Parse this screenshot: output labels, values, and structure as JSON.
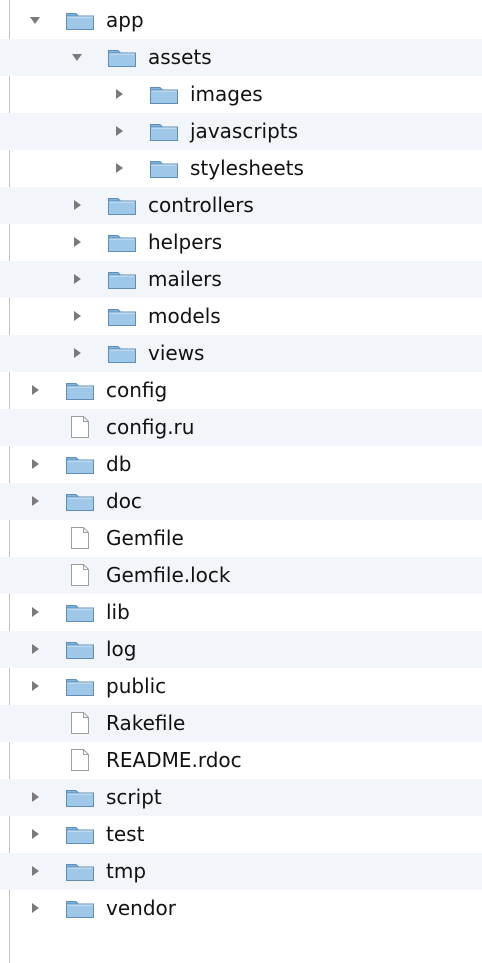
{
  "tree": {
    "items": [
      {
        "label": "app",
        "type": "folder",
        "expanded": true,
        "depth": 0
      },
      {
        "label": "assets",
        "type": "folder",
        "expanded": true,
        "depth": 1
      },
      {
        "label": "images",
        "type": "folder",
        "expanded": false,
        "depth": 2
      },
      {
        "label": "javascripts",
        "type": "folder",
        "expanded": false,
        "depth": 2
      },
      {
        "label": "stylesheets",
        "type": "folder",
        "expanded": false,
        "depth": 2
      },
      {
        "label": "controllers",
        "type": "folder",
        "expanded": false,
        "depth": 1
      },
      {
        "label": "helpers",
        "type": "folder",
        "expanded": false,
        "depth": 1
      },
      {
        "label": "mailers",
        "type": "folder",
        "expanded": false,
        "depth": 1
      },
      {
        "label": "models",
        "type": "folder",
        "expanded": false,
        "depth": 1
      },
      {
        "label": "views",
        "type": "folder",
        "expanded": false,
        "depth": 1
      },
      {
        "label": "config",
        "type": "folder",
        "expanded": false,
        "depth": 0
      },
      {
        "label": "config.ru",
        "type": "file",
        "expanded": false,
        "depth": 0
      },
      {
        "label": "db",
        "type": "folder",
        "expanded": false,
        "depth": 0
      },
      {
        "label": "doc",
        "type": "folder",
        "expanded": false,
        "depth": 0
      },
      {
        "label": "Gemfile",
        "type": "file",
        "expanded": false,
        "depth": 0
      },
      {
        "label": "Gemfile.lock",
        "type": "file",
        "expanded": false,
        "depth": 0
      },
      {
        "label": "lib",
        "type": "folder",
        "expanded": false,
        "depth": 0
      },
      {
        "label": "log",
        "type": "folder",
        "expanded": false,
        "depth": 0
      },
      {
        "label": "public",
        "type": "folder",
        "expanded": false,
        "depth": 0
      },
      {
        "label": "Rakefile",
        "type": "file",
        "expanded": false,
        "depth": 0
      },
      {
        "label": "README.rdoc",
        "type": "file",
        "expanded": false,
        "depth": 0
      },
      {
        "label": "script",
        "type": "folder",
        "expanded": false,
        "depth": 0
      },
      {
        "label": "test",
        "type": "folder",
        "expanded": false,
        "depth": 0
      },
      {
        "label": "tmp",
        "type": "folder",
        "expanded": false,
        "depth": 0
      },
      {
        "label": "vendor",
        "type": "folder",
        "expanded": false,
        "depth": 0
      }
    ]
  },
  "colors": {
    "folder_fill": "#9fc7e8",
    "folder_tab": "#7fb2dc",
    "folder_outline": "#5f8fb8",
    "file_fill": "#ffffff",
    "file_outline": "#9aa0a6",
    "disclosure": "#7a7a7a",
    "text": "#111111"
  }
}
